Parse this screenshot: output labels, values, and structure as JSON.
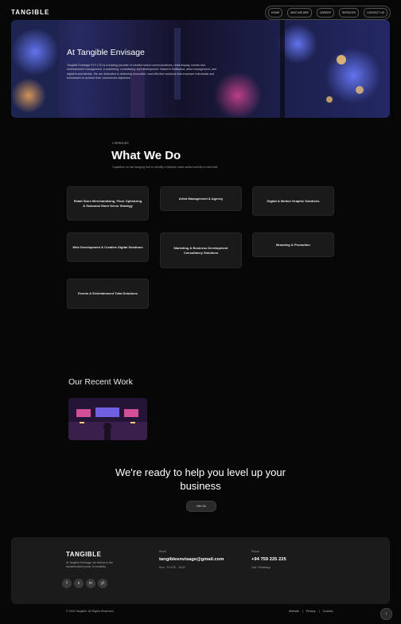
{
  "header": {
    "logo": "TANGIBLE",
    "nav": [
      "HOME",
      "WHO WE ARE",
      "CAREER",
      "SERVICES",
      "CONTACT US"
    ]
  },
  "hero": {
    "title": "At Tangible Envisage",
    "body": "Tangible Envisage PVT LTD is a leading provider of creative brand communications, retail display, events and entertainment management, e-marketing, consultancy, and development. Based in Batticaloa, artist management, and digital brand identity. We are dedicated to delivering innovative, cost-effective solutions that empower individuals and businesses to achieve their commercial objectives."
  },
  "services": {
    "eyebrow": "// SERVICES",
    "title": "What We Do",
    "subtitle": "Capitalize on low hanging fruit to identify a ballpark value added activity to beta test.",
    "cards": [
      "Retail Store Merchandising, Floor Optimizing & Seasonal Store Décor Strategy",
      "Artist Management & Agency",
      "Digital & Motion Graphic Solutions",
      "Web Development & Creative Digital Solutions",
      "Marketing & Business Development Consultancy Solutions",
      "Branding & Promotion",
      "Events & Entertainment Total Solutions"
    ]
  },
  "recent_work": {
    "title": "Our Recent Work"
  },
  "cta": {
    "title": "We're ready to help you level up your business",
    "button": "Hire Us"
  },
  "footer": {
    "logo": "TANGIBLE",
    "description": "At Tangible Envisage, we believe in the transformative power of creativity.",
    "email_label": "Email",
    "email": "tangibleenvisage@gmail.com",
    "email_note": "Mon - Fri 9:00 - 18:00",
    "phone_label": "Phone",
    "phone": "+94 759 225 225",
    "phone_note": "Call / Whatsapp",
    "copyright": "© 2024 Tangible. All Rights Reserved.",
    "links": [
      "Website",
      "Privacy",
      "Cookies"
    ],
    "link_sep": "|",
    "socials": [
      "f",
      "x",
      "in",
      "yt"
    ]
  }
}
